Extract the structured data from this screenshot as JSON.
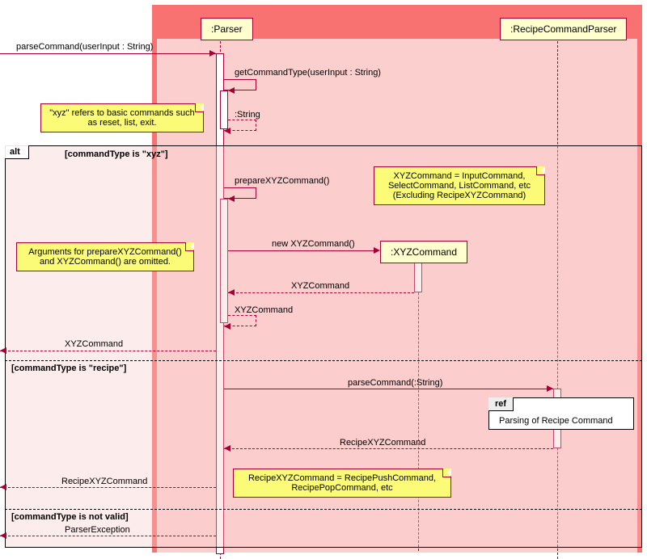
{
  "participants": {
    "parser": ":Parser",
    "recipe_parser": ":RecipeCommandParser",
    "xyz_command": ":XYZCommand"
  },
  "messages": {
    "parseCommand_in": "parseCommand(userInput : String)",
    "getCommandType": "getCommandType(userInput : String)",
    "string_ret": ":String",
    "prepareXYZ": "prepareXYZCommand()",
    "newXYZ": "new XYZCommand()",
    "xyzCmd": "XYZCommand",
    "parseCommand_recipe": "parseCommand(:String)",
    "recipeXYZ": "RecipeXYZCommand",
    "parserException": "ParserException"
  },
  "frame": {
    "alt": "alt",
    "guard1": "[commandType is \"xyz\"]",
    "guard2": "[commandType is \"recipe\"]",
    "guard3": "[commandType is not valid]"
  },
  "ref": {
    "label": "ref",
    "text": "Parsing of Recipe Command"
  },
  "notes": {
    "n1": "\"xyz\" refers to basic commands such as reset, list, exit.",
    "n2": "XYZCommand = InputCommand, SelectCommand, ListCommand, etc (Excluding RecipeXYZCommand)",
    "n3": "Arguments for prepareXYZCommand() and XYZCommand() are omitted.",
    "n4": "RecipeXYZCommand = RecipePushCommand, RecipePopCommand, etc"
  }
}
